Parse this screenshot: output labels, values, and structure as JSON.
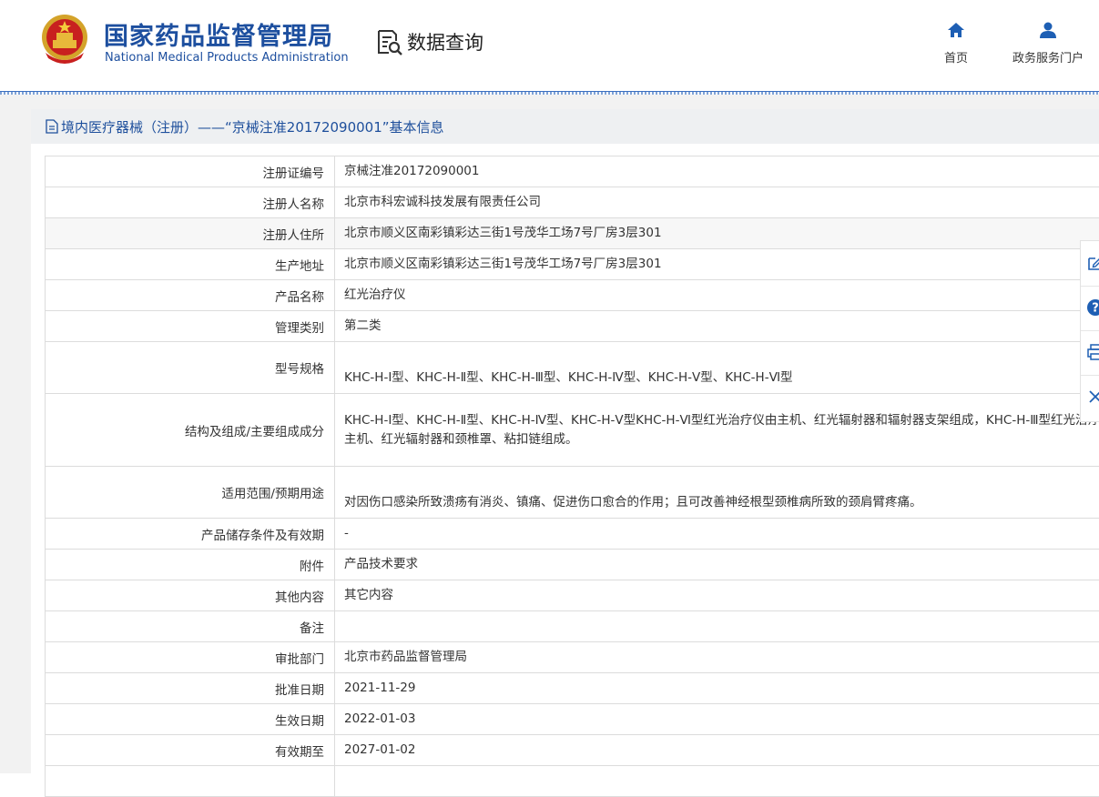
{
  "header": {
    "site_title_cn": "国家药品监督管理局",
    "site_title_en": "National Medical Products Administration",
    "section_label": "数据查询",
    "nav": [
      {
        "label": "首页",
        "icon": "home-icon"
      },
      {
        "label": "政务服务门户",
        "icon": "user-icon"
      }
    ]
  },
  "panel": {
    "title": "境内医疗器械（注册）——“京械注准20172090001”基本信息"
  },
  "rows": [
    {
      "label": "注册证编号",
      "value": "京械注准20172090001"
    },
    {
      "label": "注册人名称",
      "value": "北京市科宏诚科技发展有限责任公司"
    },
    {
      "label": "注册人住所",
      "value": "北京市顺义区南彩镇彩达三街1号茂华工场7号厂房3层301"
    },
    {
      "label": "生产地址",
      "value": "北京市顺义区南彩镇彩达三街1号茂华工场7号厂房3层301"
    },
    {
      "label": "产品名称",
      "value": "红光治疗仪"
    },
    {
      "label": "管理类别",
      "value": "第二类"
    },
    {
      "label": "型号规格",
      "value": "KHC-H-Ⅰ型、KHC-H-Ⅱ型、KHC-H-Ⅲ型、KHC-H-Ⅳ型、KHC-H-Ⅴ型、KHC-H-Ⅵ型"
    },
    {
      "label": "结构及组成/主要组成成分",
      "value": "KHC-H-Ⅰ型、KHC-H-Ⅱ型、KHC-H-Ⅳ型、KHC-H-Ⅴ型KHC-H-Ⅵ型红光治疗仪由主机、红光辐射器和辐射器支架组成，KHC-H-Ⅲ型红光治疗仪由主机、红光辐射器和颈椎罩、粘扣链组成。"
    },
    {
      "label": "适用范围/预期用途",
      "value": "对因伤口感染所致溃疡有消炎、镇痛、促进伤口愈合的作用；且可改善神经根型颈椎病所致的颈肩臂疼痛。"
    },
    {
      "label": "产品储存条件及有效期",
      "value": "-"
    },
    {
      "label": "附件",
      "value": "产品技术要求"
    },
    {
      "label": "其他内容",
      "value": "其它内容"
    },
    {
      "label": "备注",
      "value": ""
    },
    {
      "label": "审批部门",
      "value": "北京市药品监督管理局"
    },
    {
      "label": "批准日期",
      "value": "2021-11-29"
    },
    {
      "label": "生效日期",
      "value": "2022-01-03"
    },
    {
      "label": "有效期至",
      "value": "2027-01-02"
    },
    {
      "label": "",
      "value": ""
    }
  ],
  "side_tools": [
    "edit-icon",
    "help-icon",
    "print-icon",
    "close-icon"
  ],
  "colors": {
    "brand_blue": "#1d4f9f",
    "title_blue": "#1e4f9c"
  }
}
